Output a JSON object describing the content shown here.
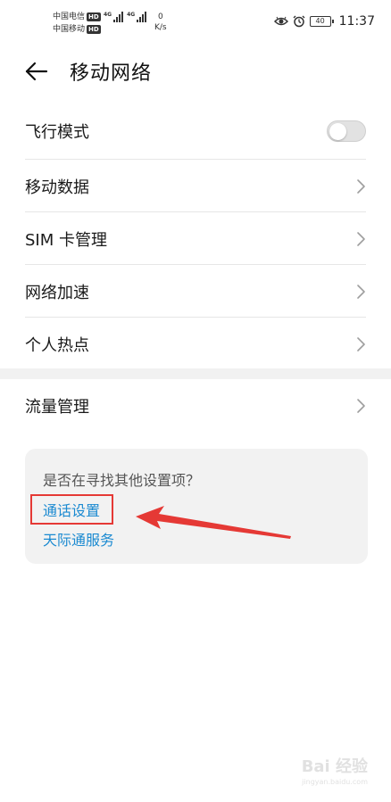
{
  "status_bar": {
    "carrier_1": "中国电信",
    "carrier_2": "中国移动",
    "hd": "HD",
    "net_type": "4G",
    "speed_value": "0",
    "speed_unit": "K/s",
    "battery": "40",
    "time": "11:37",
    "icons": [
      "eye-comfort-icon",
      "alarm-icon",
      "battery-icon"
    ]
  },
  "header": {
    "title": "移动网络",
    "back_icon": "back-arrow-icon"
  },
  "settings": {
    "items": [
      {
        "label": "飞行模式",
        "control": "toggle",
        "on": false
      },
      {
        "label": "移动数据",
        "control": "chevron"
      },
      {
        "label": "SIM 卡管理",
        "control": "chevron"
      },
      {
        "label": "网络加速",
        "control": "chevron"
      },
      {
        "label": "个人热点",
        "control": "chevron"
      },
      {
        "label": "流量管理",
        "control": "chevron"
      }
    ]
  },
  "suggestions": {
    "title": "是否在寻找其他设置项？",
    "links": [
      "通话设置",
      "天际通服务"
    ]
  },
  "annotation": {
    "highlight_color": "#e53935"
  },
  "watermark": {
    "main": "Bai 经验",
    "sub": "jingyan.baidu.com"
  },
  "colors": {
    "link": "#1b8ad1",
    "card_bg": "#f2f2f2"
  }
}
